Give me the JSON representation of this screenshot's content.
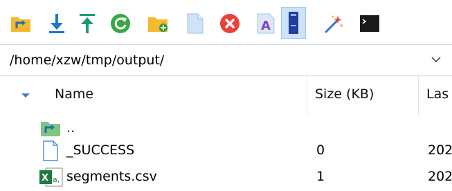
{
  "toolbar": {
    "buttons": [
      {
        "icon": "parent-folder-icon"
      },
      {
        "icon": "download-icon"
      },
      {
        "icon": "upload-icon"
      },
      {
        "icon": "refresh-icon"
      },
      {
        "icon": "new-folder-icon"
      },
      {
        "icon": "new-file-icon"
      },
      {
        "icon": "delete-icon"
      },
      {
        "icon": "rename-icon"
      },
      {
        "icon": "properties-icon",
        "selected": true
      },
      {
        "icon": "magic-wand-icon"
      },
      {
        "icon": "terminal-icon"
      }
    ]
  },
  "path_bar": {
    "value": "/home/xzw/tmp/output/",
    "dropdown_icon": "chevron-down-icon"
  },
  "table": {
    "columns": [
      "Name",
      "Size (KB)",
      "Las"
    ],
    "sort_icon": "sort-arrow-icon",
    "rows": [
      {
        "name": "..",
        "size": "",
        "last": "",
        "icon": "parent-folder-icon"
      },
      {
        "name": "_SUCCESS",
        "size": "0",
        "last": "202",
        "icon": "file-icon"
      },
      {
        "name": "segments.csv",
        "size": "1",
        "last": "202",
        "icon": "excel-csv-icon"
      }
    ]
  },
  "colors": {
    "folder": "#f5b82e",
    "arrow_blue": "#1e78c8",
    "teal": "#1a9a7a",
    "green": "#2e9b3a",
    "red": "#e8413c",
    "purple": "#8a3fc2",
    "selection": "#cfe3f7"
  }
}
